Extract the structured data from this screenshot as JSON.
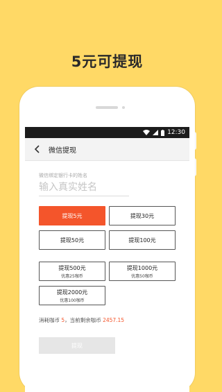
{
  "headline": "5元可提现",
  "status_bar": {
    "time": "12:30"
  },
  "header": {
    "title": "微信提现"
  },
  "form": {
    "name_label": "微信绑定银行卡的姓名",
    "name_placeholder": "输入真实姓名"
  },
  "options": [
    {
      "label": "提现5元",
      "selected": true
    },
    {
      "label": "提现30元"
    },
    {
      "label": "提现50元"
    },
    {
      "label": "提现100元"
    }
  ],
  "bonus_options": [
    {
      "label": "提现500元",
      "sub": "优惠25咖币"
    },
    {
      "label": "提现1000元",
      "sub": "优惠50咖币"
    },
    {
      "label": "提现2000元",
      "sub": "优惠100咖币"
    }
  ],
  "summary": {
    "prefix": "消耗咖币",
    "cost": "5",
    "middle": "，当前剩余咖币",
    "balance": "2457.15"
  },
  "submit_label": "提现",
  "colors": {
    "accent": "#F4552B",
    "background": "#FFD966"
  }
}
